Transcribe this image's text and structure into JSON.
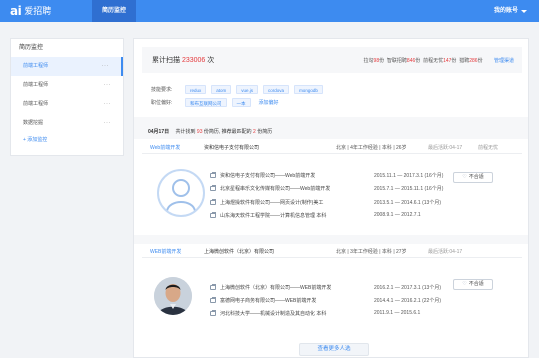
{
  "header": {
    "logo_mark": "ai",
    "logo_text": "爱招聘",
    "active_tab": "简历监控",
    "account_label": "我的账号"
  },
  "sidebar": {
    "title": "简历监控",
    "items": [
      {
        "label": "前端工程师",
        "more": "···"
      },
      {
        "label": "前端工程师",
        "more": "···"
      },
      {
        "label": "前端工程师",
        "more": "···"
      },
      {
        "label": "数据挖掘",
        "more": "···"
      }
    ],
    "add_label": "+ 添加监控"
  },
  "stats": {
    "label": "累计扫描",
    "count": "233006",
    "unit": "次",
    "items": [
      {
        "name": "拉勾",
        "value": "98",
        "suffix": "份"
      },
      {
        "name": "智联招聘",
        "value": "846",
        "suffix": "份"
      },
      {
        "name": "前程无忧",
        "value": "147",
        "suffix": "份"
      },
      {
        "name": "猎聘",
        "value": "286",
        "suffix": "份"
      }
    ],
    "manage_label": "管理渠道"
  },
  "filters": {
    "keywords_label": "技能要求:",
    "keywords": [
      "redux",
      "atom",
      "vue.js",
      "cordova",
      "mongodb"
    ],
    "position_label": "职位偏好:",
    "positions": [
      "和布互联网公司",
      "一本"
    ],
    "edit_label": "添加偏好"
  },
  "day_summary": {
    "date": "04月17日",
    "text_1": "共计找到",
    "count": "93",
    "text_2": "份简历, 推荐最匹配的",
    "top": "2",
    "text_3": "份简历"
  },
  "candidates": [
    {
      "job_tag": "Web前端开发",
      "company": "资和信电子支付有限公司",
      "meta": "北京 | 4年工作经验 | 本科 | 26岁",
      "updated": "最后活跃:04-17",
      "status": "前程无忧",
      "fit_label": "不合适",
      "experiences": [
        {
          "text": "资和信电子支付有限公司——Web前端开发",
          "dates": "2015.11.1 — 2017.3.1   (16个月)"
        },
        {
          "text": "北京星程串乐文化传媒有限公司——Web前端开发",
          "dates": "2015.7.1 — 2015.11.1   (16个月)"
        },
        {
          "text": "上海煜操软件有限公司——网页设计(制作)美工",
          "dates": "2013.5.1 — 2014.6.1   (13个月)"
        },
        {
          "text": "山东海天软件工程学院——计算机信息管理 本科",
          "dates": "2008.9.1 — 2012.7.1"
        }
      ]
    },
    {
      "job_tag": "WEB前端开发",
      "company": "上海微创软件（北京）有限公司",
      "meta": "北京 | 3年工作经验 | 本科 | 27岁",
      "updated": "最后活跃:04-17",
      "status": "",
      "fit_label": "不合适",
      "experiences": [
        {
          "text": "上海微创软件（北京）有限公司——WEB前端开发",
          "dates": "2016.2.1 — 2017.3.1   (13个月)"
        },
        {
          "text": "富德网电子商务有限公司——WEB前端开发",
          "dates": "2014.4.1 — 2016.2.1   (22个月)"
        },
        {
          "text": "河北科技大学——机械设计制造及其自动化 本科",
          "dates": "2011.9.1 — 2015.6.1"
        }
      ]
    }
  ],
  "more_label": "查看更多人选",
  "colors": {
    "brand": "#3d8bf0",
    "highlight": "#e4393c"
  }
}
